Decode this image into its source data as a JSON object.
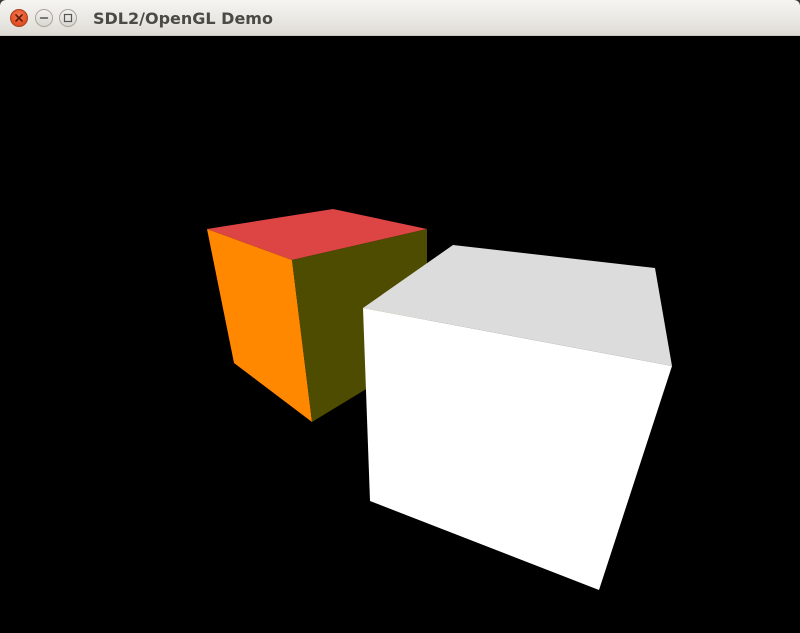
{
  "window": {
    "title": "SDL2/OpenGL Demo",
    "controls": {
      "close_icon": "close-icon",
      "minimize_icon": "minimize-icon",
      "maximize_icon": "maximize-icon"
    }
  },
  "scene": {
    "background_color": "#000000",
    "cubes": [
      {
        "name": "small-cube",
        "face_colors": {
          "top": "#dd4444",
          "left": "#ff8800",
          "right": "#4e4c00"
        }
      },
      {
        "name": "large-cube",
        "face_colors": {
          "top": "#dcdcdc",
          "front": "#ffffff"
        }
      }
    ]
  }
}
